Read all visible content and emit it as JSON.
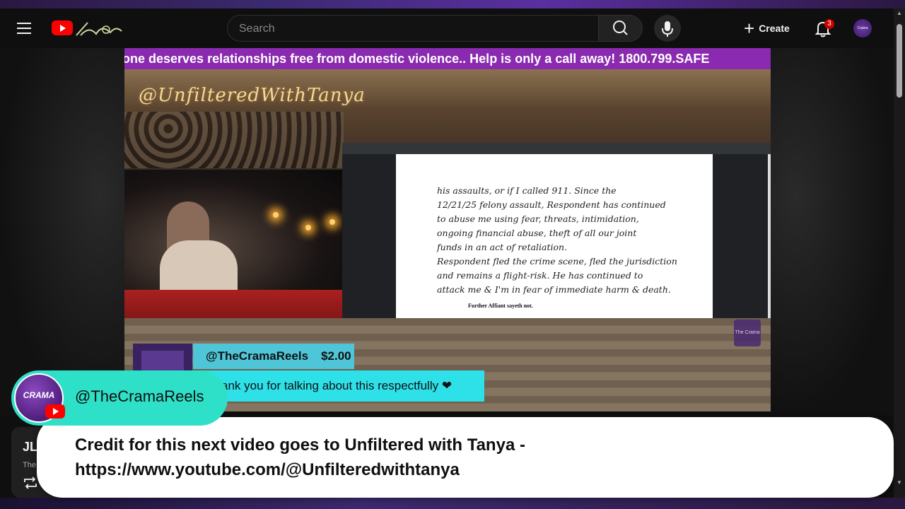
{
  "masthead": {
    "search_placeholder": "Search",
    "create_label": "Create",
    "notifications_count": "3",
    "avatar_text": "Crama"
  },
  "video": {
    "ticker_text": "one deserves relationships free from domestic violence.. Help is only a call away! 1800.799.SAFE",
    "overlay_handle": "@UnfilteredWithTanya",
    "document": {
      "lines": [
        "his assaults, or if I called 911. Since the",
        "12/21/25 felony assault, Respondent has continued",
        "to abuse me using fear, threats, intimidation,",
        "ongoing financial abuse, theft of all our joint",
        "funds in an act of retaliation.",
        "Respondent fled the crime scene, fled the jurisdiction",
        "and remains a flight-risk. He has continued to",
        "attack me & I'm in fear of immediate harm & death."
      ],
      "typed_footer": "Further Affiant sayeth not."
    },
    "donation": {
      "name": "@TheCramaReels",
      "amount": "$2.00",
      "message": "ank you for talking about this respectfully ❤"
    },
    "watermark_text": "The Crama"
  },
  "below_video": {
    "title": "JL",
    "sub": "The"
  },
  "overlay": {
    "channel_handle": "@TheCramaReels",
    "avatar_text": "CRAMA",
    "caption": "Credit for this next video goes to Unfiltered with Tanya - https://www.youtube.com/@Unfilteredwithtanya"
  },
  "colors": {
    "ticker_bg": "#8a2ab0",
    "pill_bg": "#2ee0c8",
    "donation_head_bg": "#4fc6d8",
    "donation_body_bg": "#2ee0e8",
    "yt_red": "#ff0000"
  },
  "icons": [
    "hamburger-icon",
    "youtube-logo-icon",
    "search-icon",
    "mic-icon",
    "plus-icon",
    "bell-icon",
    "repeat-icon"
  ]
}
